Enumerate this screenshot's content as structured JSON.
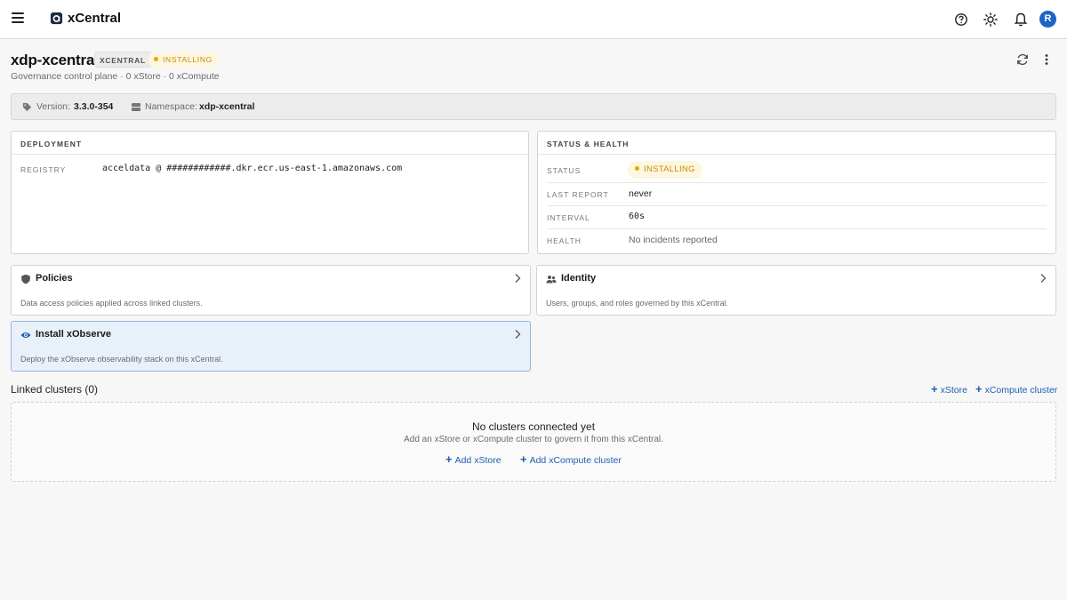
{
  "topbar": {
    "app_title": "xCentral",
    "user_initial": "R",
    "icons": [
      "menu-icon",
      "help-icon",
      "theme-toggle-icon",
      "notifications-icon"
    ]
  },
  "header": {
    "title": "xdp-xcentral",
    "type_badge": "XCENTRAL",
    "status_badge": "INSTALLING",
    "subtitle": "Governance control plane · 0 xStore · 0 xCompute"
  },
  "info": {
    "version_label": "Version:",
    "version_value": "3.3.0-354",
    "namespace_label": "Namespace:",
    "namespace_value": "xdp-xcentral"
  },
  "deployment": {
    "heading": "DEPLOYMENT",
    "registry_label": "REGISTRY",
    "registry_value": "acceldata @ ############.dkr.ecr.us-east-1.amazonaws.com"
  },
  "status_health": {
    "heading": "STATUS & HEALTH",
    "status_label": "STATUS",
    "status_value": "INSTALLING",
    "last_report_label": "LAST REPORT",
    "last_report_value": "never",
    "interval_label": "INTERVAL",
    "interval_value": "60s",
    "health_label": "HEALTH",
    "health_value": "No incidents reported"
  },
  "cards": {
    "policies": {
      "title": "Policies",
      "desc": "Data access policies applied across linked clusters."
    },
    "identity": {
      "title": "Identity",
      "desc": "Users, groups, and roles governed by this xCentral."
    },
    "xobserve": {
      "title": "Install xObserve",
      "desc": "Deploy the xObserve observability stack on this xCentral."
    }
  },
  "linked": {
    "title": "Linked clusters (0)",
    "add_xstore": "xStore",
    "add_xcompute": "xCompute cluster",
    "empty_title": "No clusters connected yet",
    "empty_desc": "Add an xStore or xCompute cluster to govern it from this xCentral.",
    "empty_add_xstore": "Add xStore",
    "empty_add_xcompute": "Add xCompute cluster"
  },
  "colors": {
    "accent": "#1e5fb3",
    "status_warning": "#c98e00",
    "status_warning_bg": "#fdf6e0",
    "avatar": "#1e63c6"
  }
}
